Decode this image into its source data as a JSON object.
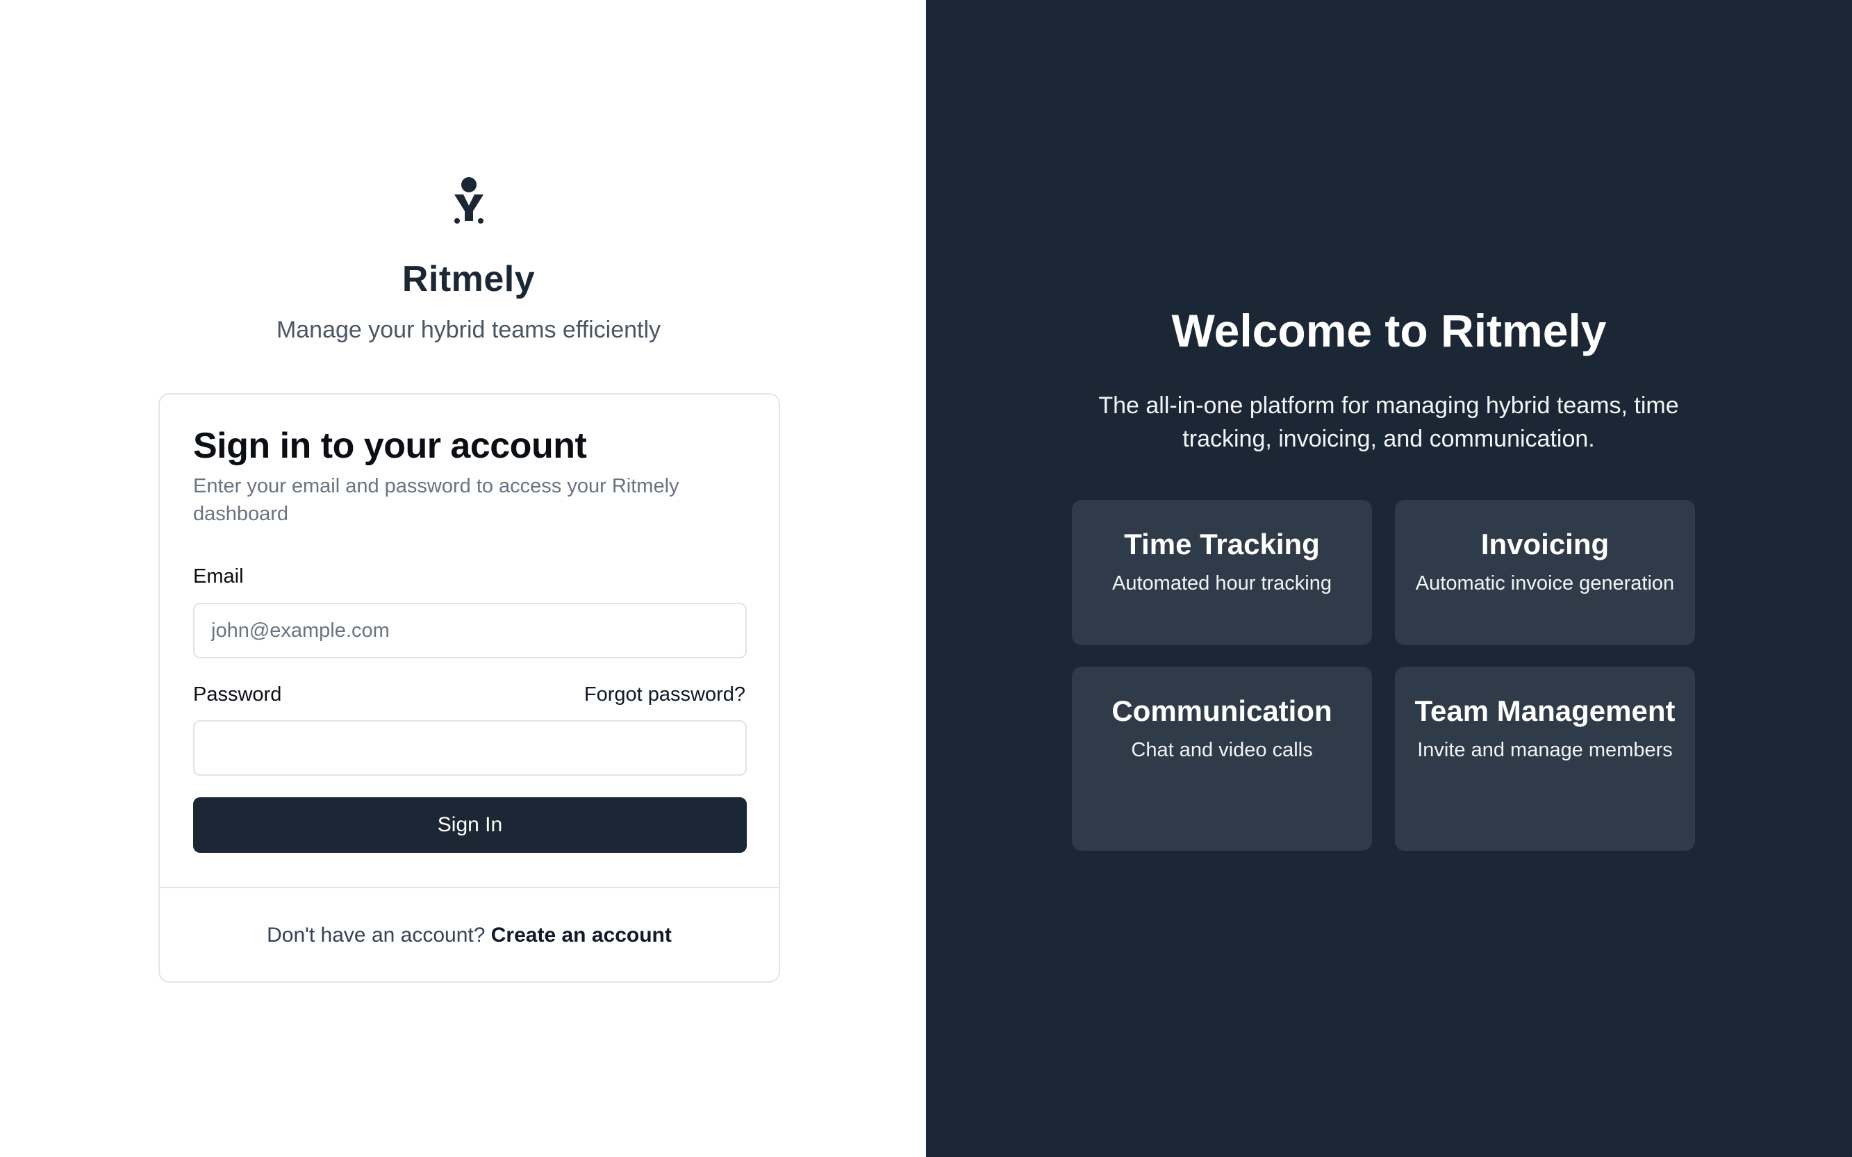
{
  "brand": {
    "name": "Ritmely",
    "tagline": "Manage your hybrid teams efficiently"
  },
  "signin": {
    "title": "Sign in to your account",
    "description": "Enter your email and password to access your Ritmely dashboard",
    "email_label": "Email",
    "email_placeholder": "john@example.com",
    "email_value": "",
    "password_label": "Password",
    "password_value": "",
    "forgot_label": "Forgot password?",
    "submit_label": "Sign In",
    "footer_text": "Don't have an account?",
    "create_account_label": "Create an account"
  },
  "welcome": {
    "title": "Welcome to Ritmely",
    "description": "The all-in-one platform for managing hybrid teams, time tracking, invoicing, and communication.",
    "features": [
      {
        "title": "Time Tracking",
        "description": "Automated hour tracking"
      },
      {
        "title": "Invoicing",
        "description": "Automatic invoice generation"
      },
      {
        "title": "Communication",
        "description": "Chat and video calls"
      },
      {
        "title": "Team Management",
        "description": "Invite and manage members"
      }
    ]
  },
  "colors": {
    "dark_panel": "#1b2734",
    "feature_card": "#2f3b48",
    "primary_button": "#1b2734"
  }
}
